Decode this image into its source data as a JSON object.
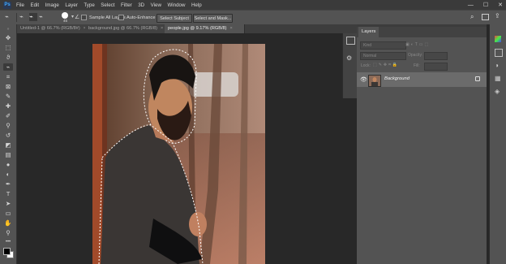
{
  "app": {
    "logo": "Ps"
  },
  "menu": [
    "File",
    "Edit",
    "Image",
    "Layer",
    "Type",
    "Select",
    "Filter",
    "3D",
    "View",
    "Window",
    "Help"
  ],
  "window_controls": {
    "minimize": "—",
    "maximize": "☐",
    "close": "✕"
  },
  "options_bar": {
    "brush_size": "45",
    "sample_all_layers": "Sample All Layers",
    "auto_enhance": "Auto-Enhance",
    "select_subject": "Select Subject",
    "select_and_mask": "Select and Mask..."
  },
  "tabs": [
    {
      "label": "Untitled-1 @ 66.7% (RGB/8#)",
      "close": "×"
    },
    {
      "label": "background.jpg @ 66.7% (RGB/8)",
      "close": "×"
    },
    {
      "label": "people.jpg @ 9.17% (RGB/8)",
      "close": "×"
    }
  ],
  "layers_panel": {
    "tab_label": "Layers",
    "kind_placeholder": "Kind",
    "blend_mode": "Normal",
    "opacity_label": "Opacity:",
    "lock_label": "Lock:",
    "fill_label": "Fill:",
    "layer_name": "Background"
  },
  "colors": {
    "accent": "#3fa9ff",
    "selected_layer": "#6b6b6b",
    "foreground_swatch": "#000000",
    "background_swatch": "#ffffff"
  },
  "icons": [
    "move-icon",
    "marquee-icon",
    "lasso-icon",
    "quick-selection-icon",
    "crop-icon",
    "eyedropper-icon",
    "healing-icon",
    "brush-icon",
    "stamp-icon",
    "history-brush-icon",
    "eraser-icon",
    "gradient-icon",
    "blur-icon",
    "dodge-icon",
    "pen-icon",
    "type-icon",
    "path-selection-icon",
    "shape-icon",
    "hand-icon",
    "zoom-icon",
    "eye-icon",
    "lock-icon"
  ]
}
